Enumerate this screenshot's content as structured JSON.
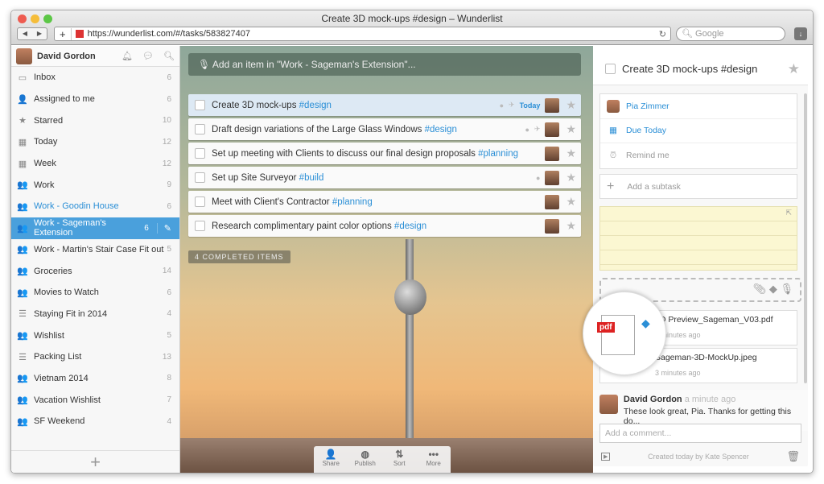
{
  "window": {
    "title": "Create 3D mock-ups #design – Wunderlist",
    "url": "https://wunderlist.com/#/tasks/583827407",
    "search_placeholder": "Google"
  },
  "user": {
    "name": "David Gordon"
  },
  "sidebar": {
    "items": [
      {
        "label": "Inbox",
        "count": "6",
        "icon": "inbox-icon",
        "glyph": "▭"
      },
      {
        "label": "Assigned to me",
        "count": "6",
        "icon": "person-icon",
        "glyph": "👤"
      },
      {
        "label": "Starred",
        "count": "10",
        "icon": "star-icon",
        "glyph": "★"
      },
      {
        "label": "Today",
        "count": "12",
        "icon": "calendar-icon",
        "glyph": "▦"
      },
      {
        "label": "Week",
        "count": "12",
        "icon": "calendar-week-icon",
        "glyph": "▦"
      },
      {
        "label": "Work",
        "count": "9",
        "icon": "shared-list-icon",
        "glyph": "👥"
      },
      {
        "label": "Work - Goodin House",
        "count": "6",
        "icon": "shared-list-icon",
        "glyph": "👥"
      },
      {
        "label": "Work - Sageman's Extension",
        "count": "6",
        "icon": "shared-list-icon",
        "glyph": "👥"
      },
      {
        "label": "Work - Martin's Stair Case Fit out",
        "count": "5",
        "icon": "shared-list-icon",
        "glyph": "👥"
      },
      {
        "label": "Groceries",
        "count": "14",
        "icon": "shared-list-icon",
        "glyph": "👥"
      },
      {
        "label": "Movies to Watch",
        "count": "6",
        "icon": "shared-list-icon",
        "glyph": "👥"
      },
      {
        "label": "Staying Fit in 2014",
        "count": "4",
        "icon": "list-icon",
        "glyph": "☰"
      },
      {
        "label": "Wishlist",
        "count": "5",
        "icon": "shared-list-icon",
        "glyph": "👥"
      },
      {
        "label": "Packing List",
        "count": "13",
        "icon": "list-icon",
        "glyph": "☰"
      },
      {
        "label": "Vietnam 2014",
        "count": "8",
        "icon": "shared-list-icon",
        "glyph": "👥"
      },
      {
        "label": "Vacation Wishlist",
        "count": "7",
        "icon": "shared-list-icon",
        "glyph": "👥"
      },
      {
        "label": "SF Weekend",
        "count": "4",
        "icon": "shared-list-icon",
        "glyph": "👥"
      }
    ],
    "add_glyph": "+"
  },
  "main": {
    "add_placeholder": "Add an item in \"Work - Sageman's Extension\"...",
    "tasks": [
      {
        "text": "Create 3D mock-ups ",
        "tag": "#design",
        "due": "Today"
      },
      {
        "text": "Draft design variations of the Large Glass Windows ",
        "tag": "#design",
        "due": ""
      },
      {
        "text": "Set up meeting with Clients to discuss our final design proposals ",
        "tag": "#planning",
        "due": ""
      },
      {
        "text": "Set up Site Surveyor ",
        "tag": "#build",
        "due": ""
      },
      {
        "text": "Meet with Client's Contractor ",
        "tag": "#planning",
        "due": ""
      },
      {
        "text": "Research complimentary paint color options ",
        "tag": "#design",
        "due": ""
      }
    ],
    "completed_label": "4 COMPLETED ITEMS",
    "toolbar": [
      {
        "label": "Share",
        "glyph": "👤"
      },
      {
        "label": "Publish",
        "glyph": "◍"
      },
      {
        "label": "Sort",
        "glyph": "⇅"
      },
      {
        "label": "More",
        "glyph": "•••"
      }
    ]
  },
  "detail": {
    "title": "Create 3D mock-ups #design",
    "assignee": "Pia Zimmer",
    "due": "Due Today",
    "reminder": "Remind me",
    "subtask_placeholder": "Add a subtask",
    "files": [
      {
        "name": "3D Preview_Sageman_V03.pdf",
        "time": "3 minutes ago"
      },
      {
        "name": "Sageman-3D-MockUp.jpeg",
        "time": "3 minutes ago"
      }
    ],
    "pdf_label": "pdf",
    "comment": {
      "author": "David Gordon",
      "time": "a minute ago",
      "text": "These look great, Pia. Thanks for getting this do..."
    },
    "comment_placeholder": "Add a comment...",
    "footer": "Created today by Kate Spencer"
  },
  "colors": {
    "accent": "#4aa0dc",
    "tag": "#2b8fd6"
  }
}
